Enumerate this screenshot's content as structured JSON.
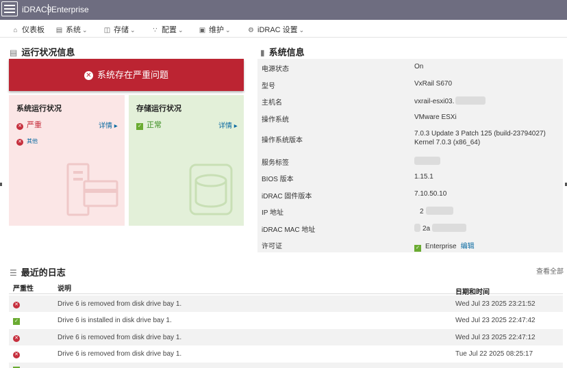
{
  "header": {
    "brand": "iDRAC9",
    "edition": "Enterprise"
  },
  "nav": [
    {
      "label": "仪表板",
      "icon": "home-icon",
      "has_menu": false
    },
    {
      "label": "系统",
      "icon": "server-icon",
      "has_menu": true
    },
    {
      "label": "存储",
      "icon": "database-icon",
      "has_menu": true
    },
    {
      "label": "配置",
      "icon": "sliders-icon",
      "has_menu": true
    },
    {
      "label": "维护",
      "icon": "maintenance-icon",
      "has_menu": true
    },
    {
      "label": "iDRAC 设置",
      "icon": "settings-icon",
      "has_menu": true
    }
  ],
  "health": {
    "title": "运行状况信息",
    "banner": "系统存在严重问题",
    "system": {
      "title": "系统运行状况",
      "status": "严重",
      "detail": "详情",
      "sub_item": "其他"
    },
    "storage": {
      "title": "存储运行状况",
      "status": "正常",
      "detail": "详情"
    }
  },
  "sysinfo": {
    "title": "系统信息",
    "rows": [
      {
        "key": "电源状态",
        "value": "On"
      },
      {
        "key": "型号",
        "value": "VxRail S670"
      },
      {
        "key": "主机名",
        "value": "vxrail-esxi03."
      },
      {
        "key": "操作系统",
        "value": "VMware ESXi"
      },
      {
        "key": "操作系统版本",
        "value": "7.0.3 Update 3 Patch 125 (build-23794027) Kernel 7.0.3 (x86_64)"
      },
      {
        "key": "服务标签",
        "value": ""
      },
      {
        "key": "BIOS 版本",
        "value": "1.15.1"
      },
      {
        "key": "iDRAC 固件版本",
        "value": "7.10.50.10"
      },
      {
        "key": "IP 地址",
        "value": "2"
      },
      {
        "key": "iDRAC MAC 地址",
        "value": "2a"
      },
      {
        "key": "许可证",
        "value": "Enterprise",
        "action": "编辑"
      }
    ]
  },
  "logs": {
    "title": "最近的日志",
    "view_all": "查看全部",
    "columns": {
      "severity": "严重性",
      "description": "说明",
      "datetime": "日期和时间"
    },
    "rows": [
      {
        "severity": "critical",
        "description": "Drive 6 is removed from disk drive bay 1.",
        "datetime": "Wed Jul 23 2025 23:21:52"
      },
      {
        "severity": "ok",
        "description": "Drive 6 is installed in disk drive bay 1.",
        "datetime": "Wed Jul 23 2025 22:47:42"
      },
      {
        "severity": "critical",
        "description": "Drive 6 is removed from disk drive bay 1.",
        "datetime": "Wed Jul 23 2025 22:47:12"
      },
      {
        "severity": "critical",
        "description": "Drive 6 is removed from disk drive bay 1.",
        "datetime": "Tue Jul 22 2025 08:25:17"
      }
    ]
  },
  "colors": {
    "header_bg": "#6e6d80",
    "critical": "#bc2432",
    "ok": "#6aab31",
    "link": "#0a6aa1"
  }
}
